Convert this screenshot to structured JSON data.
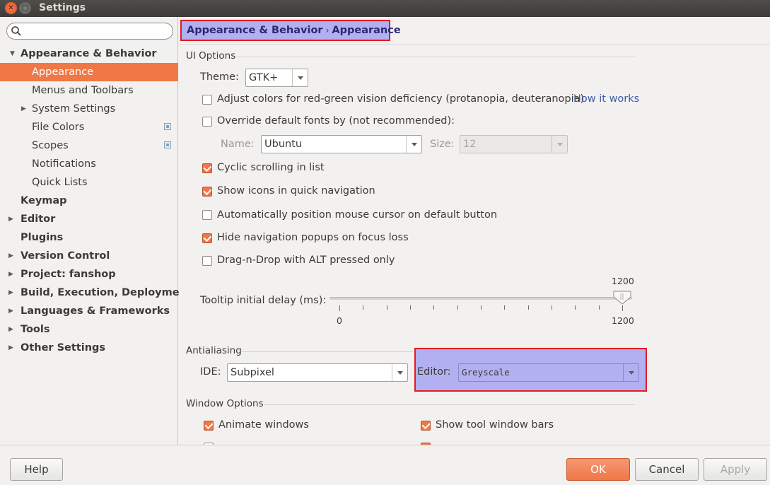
{
  "window": {
    "title": "Settings"
  },
  "search": {
    "placeholder": ""
  },
  "sidebar": {
    "items": [
      {
        "label": "Appearance & Behavior",
        "bold": true,
        "expanded": true
      },
      {
        "label": "Appearance",
        "selected": true
      },
      {
        "label": "Menus and Toolbars"
      },
      {
        "label": "System Settings"
      },
      {
        "label": "File Colors"
      },
      {
        "label": "Scopes"
      },
      {
        "label": "Notifications"
      },
      {
        "label": "Quick Lists"
      },
      {
        "label": "Keymap",
        "bold": true
      },
      {
        "label": "Editor",
        "bold": true
      },
      {
        "label": "Plugins",
        "bold": true
      },
      {
        "label": "Version Control",
        "bold": true
      },
      {
        "label": "Project: fanshop",
        "bold": true
      },
      {
        "label": "Build, Execution, Deployment",
        "bold": true
      },
      {
        "label": "Languages & Frameworks",
        "bold": true
      },
      {
        "label": "Tools",
        "bold": true
      },
      {
        "label": "Other Settings",
        "bold": true
      }
    ]
  },
  "breadcrumb": {
    "part1": "Appearance & Behavior",
    "separator": "›",
    "part2": "Appearance"
  },
  "ui_options": {
    "title": "UI Options",
    "theme_label": "Theme:",
    "theme_value": "GTK+",
    "adjust_colors_label": "Adjust colors for red-green vision deficiency (protanopia, deuteranopia)",
    "adjust_colors_checked": false,
    "how_it_works": "How it works",
    "override_fonts_label": "Override default fonts by (not recommended):",
    "override_fonts_checked": false,
    "name_label": "Name:",
    "name_value": "Ubuntu",
    "size_label": "Size:",
    "size_value": "12",
    "cyclic_label": "Cyclic scrolling in list",
    "cyclic_checked": true,
    "show_icons_label": "Show icons in quick navigation",
    "show_icons_checked": true,
    "auto_cursor_label": "Automatically position mouse cursor on default button",
    "auto_cursor_checked": false,
    "hide_popups_label": "Hide navigation popups on focus loss",
    "hide_popups_checked": true,
    "dnd_label": "Drag-n-Drop with ALT pressed only",
    "dnd_checked": false,
    "tooltip_label": "Tooltip initial delay (ms):",
    "tooltip_value": "1200",
    "tooltip_min": "0",
    "tooltip_max": "1200",
    "tooltip_fraction": 1.0
  },
  "antialiasing": {
    "title": "Antialiasing",
    "ide_label": "IDE:",
    "ide_value": "Subpixel",
    "editor_label": "Editor:",
    "editor_value": "Greyscale"
  },
  "window_options": {
    "title": "Window Options",
    "animate_label": "Animate windows",
    "animate_checked": true,
    "show_tool_bars_label": "Show tool window bars",
    "show_tool_bars_checked": true
  },
  "buttons": {
    "help": "Help",
    "ok": "OK",
    "cancel": "Cancel",
    "apply": "Apply"
  },
  "colors": {
    "accent": "#f07746",
    "highlight": "#b3b0f1",
    "annotation_border": "#e11b22"
  }
}
